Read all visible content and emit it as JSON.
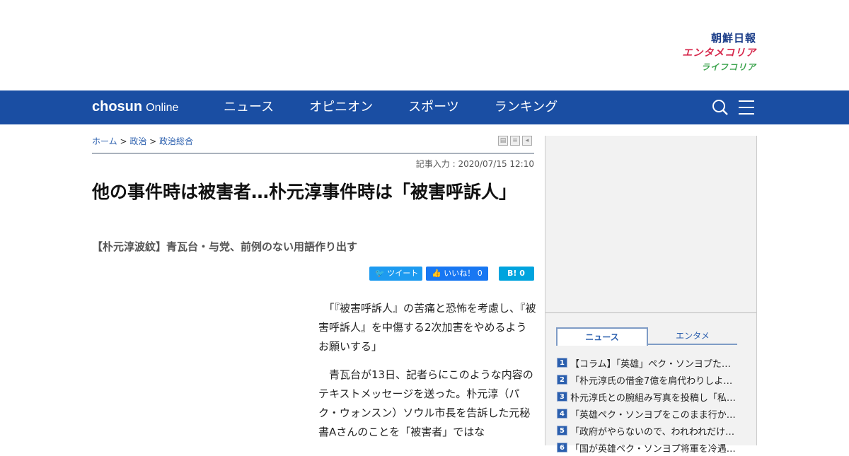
{
  "brands": {
    "chosun": "朝鮮日報",
    "entame": "エンタメコリア",
    "life": "ライフコリア"
  },
  "nav": {
    "logo_main": "chosun",
    "logo_sub": "Online",
    "items": [
      "ニュース",
      "オピニオン",
      "スポーツ",
      "ランキング"
    ],
    "search_icon": "search-icon",
    "menu_icon": "hamburger-icon"
  },
  "breadcrumb": {
    "home": "ホーム",
    "sep": " > ",
    "section": "政治",
    "subsection": "政治総合"
  },
  "article": {
    "date": "記事入力 : 2020/07/15 12:10",
    "title": "他の事件時は被害者…朴元淳事件時は「被害呼訴人」",
    "subtitle": "【朴元淳波紋】青瓦台・与党、前例のない用語作り出す",
    "paragraphs": [
      "　「『被害呼訴人』の苦痛と恐怖を考慮し、『被害呼訴人』を中傷する2次加害をやめるようお願いする」",
      "　青瓦台が13日、記者らにこのような内容のテキストメッセージを送った。朴元淳（パク・ウォンスン）ソウル市長を告訴した元秘書Aさんのことを「被害者」ではな"
    ]
  },
  "share": {
    "tweet": "ツイート",
    "like": "いいね！ 0",
    "hatena": "B! 0"
  },
  "sidebar": {
    "tabs": [
      "ニュース",
      "エンタメ"
    ],
    "ranking": [
      {
        "num": "1",
        "text": "【コラム】「英雄」ペク・ソンヨプた…"
      },
      {
        "num": "2",
        "text": "「朴元淳氏の借金7億を肩代わりしよ…"
      },
      {
        "num": "3",
        "text": "朴元淳氏との腕組み写真を投稿し「私…"
      },
      {
        "num": "4",
        "text": "「英雄ペク・ソンヨプをこのまま行か…"
      },
      {
        "num": "5",
        "text": "「政府がやらないので、われわれだけ…"
      },
      {
        "num": "6",
        "text": "「国が英雄ペク・ソンヨプ将軍を冷遇…"
      }
    ]
  }
}
